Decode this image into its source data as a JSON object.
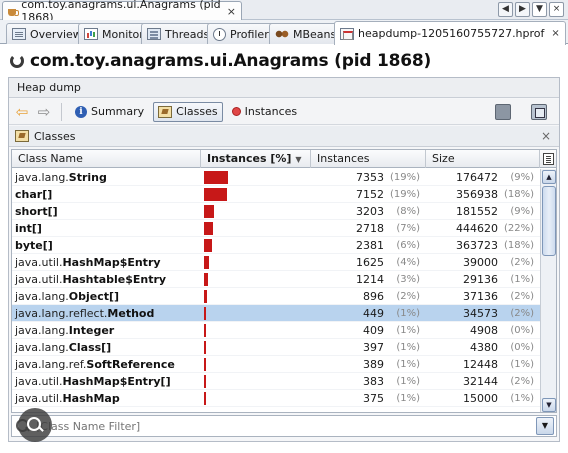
{
  "window": {
    "doc_tab_title": "com.toy.anagrams.ui.Anagrams (pid 1868)",
    "close_glyph": "×",
    "nav": {
      "left": "◀",
      "right": "▶",
      "menu": "▼",
      "close": "×"
    }
  },
  "tool_tabs": [
    {
      "label": "Overview",
      "icon": "document-icon"
    },
    {
      "label": "Monitor",
      "icon": "chart-icon"
    },
    {
      "label": "Threads",
      "icon": "threads-icon"
    },
    {
      "label": "Profiler",
      "icon": "clock-icon"
    },
    {
      "label": "MBeans",
      "icon": "beans-icon"
    },
    {
      "label": "heapdump-1205160755727.hprof",
      "icon": "heapdump-icon",
      "active": true
    }
  ],
  "page_title": "com.toy.anagrams.ui.Anagrams (pid 1868)",
  "panel": {
    "header": "Heap dump",
    "toolbar": {
      "back": "⇦",
      "forward": "⇨",
      "summary_label": "Summary",
      "classes_label": "Classes",
      "instances_label": "Instances"
    },
    "section_title": "Classes",
    "section_close": "×"
  },
  "table": {
    "columns": {
      "name": "Class Name",
      "bar": "Instances [%]",
      "instances": "Instances",
      "size": "Size"
    },
    "sort_glyph": "▼",
    "rows": [
      {
        "pkg": "java.lang.",
        "cls": "String",
        "share": 0.19,
        "instances": "7353",
        "instances_pct": "(19%)",
        "size": "176472",
        "size_pct": "(9%)"
      },
      {
        "pkg": "",
        "cls": "char[]",
        "share": 0.185,
        "instances": "7152",
        "instances_pct": "(19%)",
        "size": "356938",
        "size_pct": "(18%)"
      },
      {
        "pkg": "",
        "cls": "short[]",
        "share": 0.08,
        "instances": "3203",
        "instances_pct": "(8%)",
        "size": "181552",
        "size_pct": "(9%)"
      },
      {
        "pkg": "",
        "cls": "int[]",
        "share": 0.07,
        "instances": "2718",
        "instances_pct": "(7%)",
        "size": "444620",
        "size_pct": "(22%)"
      },
      {
        "pkg": "",
        "cls": "byte[]",
        "share": 0.06,
        "instances": "2381",
        "instances_pct": "(6%)",
        "size": "363723",
        "size_pct": "(18%)"
      },
      {
        "pkg": "java.util.",
        "cls": "HashMap$Entry",
        "share": 0.04,
        "instances": "1625",
        "instances_pct": "(4%)",
        "size": "39000",
        "size_pct": "(2%)"
      },
      {
        "pkg": "java.util.",
        "cls": "Hashtable$Entry",
        "share": 0.03,
        "instances": "1214",
        "instances_pct": "(3%)",
        "size": "29136",
        "size_pct": "(1%)"
      },
      {
        "pkg": "java.lang.",
        "cls": "Object[]",
        "share": 0.02,
        "instances": "896",
        "instances_pct": "(2%)",
        "size": "37136",
        "size_pct": "(2%)"
      },
      {
        "pkg": "java.lang.reflect.",
        "cls": "Method",
        "share": 0.012,
        "instances": "449",
        "instances_pct": "(1%)",
        "size": "34573",
        "size_pct": "(2%)",
        "selected": true
      },
      {
        "pkg": "java.lang.",
        "cls": "Integer",
        "share": 0.01,
        "instances": "409",
        "instances_pct": "(1%)",
        "size": "4908",
        "size_pct": "(0%)"
      },
      {
        "pkg": "java.lang.",
        "cls": "Class[]",
        "share": 0.01,
        "instances": "397",
        "instances_pct": "(1%)",
        "size": "4380",
        "size_pct": "(0%)"
      },
      {
        "pkg": "java.lang.ref.",
        "cls": "SoftReference",
        "share": 0.01,
        "instances": "389",
        "instances_pct": "(1%)",
        "size": "12448",
        "size_pct": "(1%)"
      },
      {
        "pkg": "java.util.",
        "cls": "HashMap$Entry[]",
        "share": 0.01,
        "instances": "383",
        "instances_pct": "(1%)",
        "size": "32144",
        "size_pct": "(2%)"
      },
      {
        "pkg": "java.util.",
        "cls": "HashMap",
        "share": 0.01,
        "instances": "375",
        "instances_pct": "(1%)",
        "size": "15000",
        "size_pct": "(1%)"
      }
    ],
    "bar_color": "#c71818",
    "selected_color": "#b9d3ee"
  },
  "filter": {
    "placeholder": "[Class Name Filter]",
    "dropdown_glyph": "▼"
  },
  "scrollbar": {
    "up": "▲",
    "down": "▼"
  }
}
